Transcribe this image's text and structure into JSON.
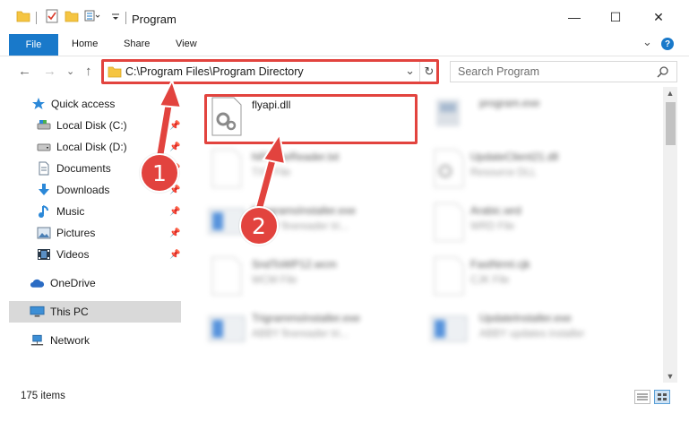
{
  "window": {
    "title": "Program",
    "minimize": "—",
    "maximize": "☐",
    "close": "✕"
  },
  "ribbon": {
    "tabs": [
      "File",
      "Home",
      "Share",
      "View"
    ],
    "expand": "⌄",
    "help": "?"
  },
  "address_bar": {
    "path": "C:\\Program Files\\Program Directory",
    "dropdown": "⌄",
    "refresh": "↻"
  },
  "search": {
    "placeholder": "Search Program"
  },
  "nav": {
    "back": "←",
    "forward": "→",
    "recent": "⌄",
    "up": "↑"
  },
  "sidebar": {
    "items": [
      {
        "label": "Quick access",
        "icon": "star-icon"
      },
      {
        "label": "Local Disk (C:)",
        "icon": "drive-icon",
        "pinned": true
      },
      {
        "label": "Local Disk (D:)",
        "icon": "drive-icon",
        "pinned": true
      },
      {
        "label": "Documents",
        "icon": "documents-icon",
        "pinned": true
      },
      {
        "label": "Downloads",
        "icon": "download-icon",
        "pinned": true
      },
      {
        "label": "Music",
        "icon": "music-icon",
        "pinned": true
      },
      {
        "label": "Pictures",
        "icon": "pictures-icon",
        "pinned": true
      },
      {
        "label": "Videos",
        "icon": "videos-icon",
        "pinned": true
      },
      {
        "label": "OneDrive",
        "icon": "cloud-icon"
      },
      {
        "label": "This PC",
        "icon": "computer-icon",
        "selected": true
      },
      {
        "label": "Network",
        "icon": "network-icon"
      }
    ],
    "pin_glyph": "📌"
  },
  "files": [
    {
      "name": "flyapi.dll",
      "type": "",
      "icon": "dll-gear-icon",
      "highlighted": true
    },
    {
      "name": "program.exe",
      "type": "",
      "icon": "exe-icon"
    },
    {
      "name": "hiFlameReader.txt",
      "type": "TXT File",
      "icon": "text-file-icon"
    },
    {
      "name": "UpdateClient21.dll",
      "type": "Resource DLL",
      "icon": "dll-gear-icon"
    },
    {
      "name": "ProgramsInstaller.exe",
      "type": "ABBY finereader tri...",
      "icon": "installer-icon"
    },
    {
      "name": "Arabic.wrd",
      "type": "WRD File",
      "icon": "blank-file-icon"
    },
    {
      "name": "SndToWP12.wcm",
      "type": "WCM File",
      "icon": "blank-file-icon"
    },
    {
      "name": "FastNrml.cjk",
      "type": "CJK File",
      "icon": "blank-file-icon"
    },
    {
      "name": "TrigrammsInstaller.exe",
      "type": "ABBY finereader tri...",
      "icon": "installer-icon"
    },
    {
      "name": "UpdateInstaller.exe",
      "type": "ABBY updates installer",
      "icon": "installer-icon"
    }
  ],
  "status": {
    "items_count": "175 items"
  },
  "callouts": [
    "1",
    "2"
  ],
  "colors": {
    "accent": "#1979ca",
    "highlight": "#e2433e",
    "selection": "#d9d9d9",
    "folder": "#f5c542"
  }
}
